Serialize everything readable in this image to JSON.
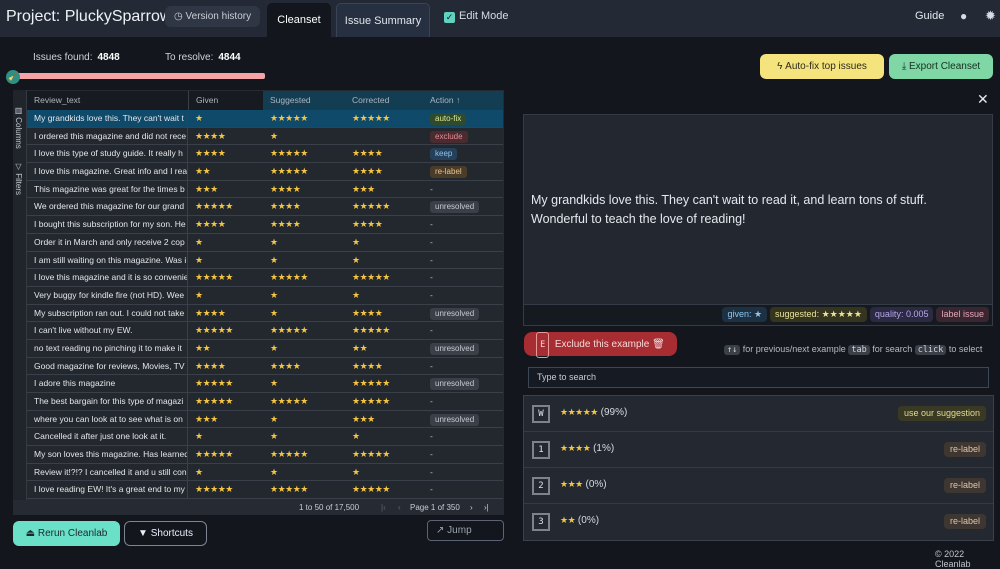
{
  "header": {
    "title": "Project: PluckySparrow",
    "version_history": "Version history",
    "tabs": [
      "Cleanset",
      "Issue Summary"
    ],
    "edit_mode": "Edit Mode",
    "guide": "Guide"
  },
  "stats": {
    "issues_label": "Issues found:",
    "issues": "4848",
    "resolve_label": "To resolve:",
    "resolve": "4844",
    "progress_fraction": 1.0
  },
  "table": {
    "side": [
      "Columns",
      "Filters"
    ],
    "columns": [
      "Review_text",
      "Given",
      "Suggested",
      "Corrected",
      "Action ↑"
    ],
    "rows": [
      [
        "My grandkids love this. They can't wait t",
        "★",
        "★★★★★",
        "★★★★★",
        "auto-fix"
      ],
      [
        "I ordered this magazine and did not rece",
        "★★★★",
        "★",
        "",
        "exclude"
      ],
      [
        "I love this type of study guide. It really h",
        "★★★★",
        "★★★★★",
        "★★★★",
        "keep"
      ],
      [
        "I love this magazine. Great info and I rea",
        "★★",
        "★★★★★",
        "★★★★",
        "re-label"
      ],
      [
        "This magazine was great for the times b",
        "★★★",
        "★★★★",
        "★★★",
        "-"
      ],
      [
        "We ordered this magazine for our grand",
        "★★★★★",
        "★★★★",
        "★★★★★",
        "unresolved"
      ],
      [
        "I bought this subscription for my son. He",
        "★★★★",
        "★★★★",
        "★★★★",
        "-"
      ],
      [
        "Order it in March and only receive 2 cop",
        "★",
        "★",
        "★",
        "-"
      ],
      [
        "I am still waiting on this magazine. Was i",
        "★",
        "★",
        "★",
        "-"
      ],
      [
        "I love this magazine and it is so convenie",
        "★★★★★",
        "★★★★★",
        "★★★★★",
        "-"
      ],
      [
        "Very buggy for kindle fire (not HD). Wee",
        "★",
        "★",
        "★",
        "-"
      ],
      [
        "My subscription ran out. I could not take",
        "★★★★",
        "★",
        "★★★★",
        "unresolved"
      ],
      [
        "I can't live without my EW.",
        "★★★★★",
        "★★★★★",
        "★★★★★",
        "-"
      ],
      [
        "no text reading no pinching it to make it",
        "★★",
        "★",
        "★★",
        "unresolved"
      ],
      [
        "Good magazine for reviews, Movies, TV",
        "★★★★",
        "★★★★",
        "★★★★",
        "-"
      ],
      [
        "I adore this magazine",
        "★★★★★",
        "★",
        "★★★★★",
        "unresolved"
      ],
      [
        "The best bargain for this type of magazi",
        "★★★★★",
        "★★★★★",
        "★★★★★",
        "-"
      ],
      [
        "where you can look at to see what is on",
        "★★★",
        "★",
        "★★★",
        "unresolved"
      ],
      [
        "Cancelled it after just one look at it.",
        "★",
        "★",
        "★",
        "-"
      ],
      [
        "My son loves this magazine. Has learned",
        "★★★★★",
        "★★★★★",
        "★★★★★",
        "-"
      ],
      [
        "Review it!?!? I cancelled it and u still con",
        "★",
        "★",
        "★",
        "-"
      ],
      [
        "I love reading EW! It's a great end to my",
        "★★★★★",
        "★★★★★",
        "★★★★★",
        "-"
      ]
    ],
    "range": "1 to 50 of 17,500",
    "page": "Page 1 of 350"
  },
  "buttons": {
    "rerun": "Rerun Cleanlab",
    "shortcuts": "Shortcuts",
    "jump": "Jump",
    "autofix": "Auto-fix top issues",
    "export": "Export Cleanset",
    "exclude": "Exclude this example",
    "exclude_key": "E"
  },
  "detail": {
    "text": "My grandkids love this. They can't wait to read it, and learn tons of stuff. Wonderful to teach the love of reading!",
    "badges": {
      "given": "given: ★",
      "suggested": "suggested: ★★★★★",
      "quality": "quality: 0.005",
      "issue": "label issue"
    }
  },
  "hints": {
    "k1": "↑↓",
    "t1": "for previous/next example",
    "k2": "tab",
    "t2": "for search",
    "k3": "click",
    "t3": "to select"
  },
  "search": {
    "placeholder": "Type to search"
  },
  "options": [
    {
      "key": "W",
      "stars": "★★★★★",
      "pct": "(99%)",
      "action": "use our suggestion"
    },
    {
      "key": "1",
      "stars": "★★★★",
      "pct": "(1%)",
      "action": "re-label"
    },
    {
      "key": "2",
      "stars": "★★★",
      "pct": "(0%)",
      "action": "re-label"
    },
    {
      "key": "3",
      "stars": "★★",
      "pct": "(0%)",
      "action": "re-label"
    }
  ],
  "footer": "© 2022 Cleanlab"
}
